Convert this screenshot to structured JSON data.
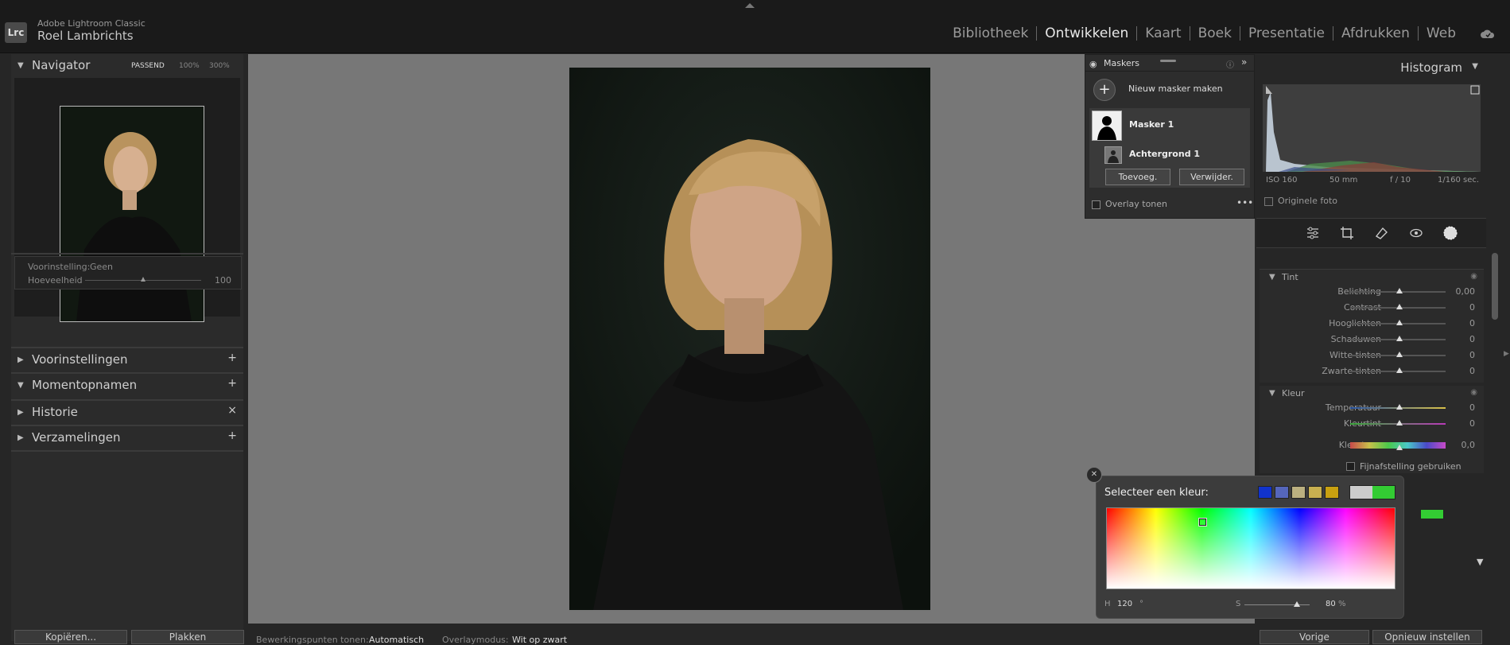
{
  "app": {
    "logo": "Lrc",
    "name": "Adobe Lightroom Classic",
    "user": "Roel Lambrichts"
  },
  "modules": [
    "Bibliotheek",
    "Ontwikkelen",
    "Kaart",
    "Boek",
    "Presentatie",
    "Afdrukken",
    "Web"
  ],
  "active_module": "Ontwikkelen",
  "navigator": {
    "title": "Navigator",
    "zoom": [
      "PASSEND",
      "100%",
      "300%"
    ]
  },
  "preset_box": {
    "label": "Voorinstelling:",
    "value": "Geen",
    "amount_label": "Hoeveelheid",
    "amount": "100"
  },
  "left_panels": [
    {
      "label": "Voorinstellingen",
      "action": "+"
    },
    {
      "label": "Momentopnamen",
      "action": "+"
    },
    {
      "label": "Historie",
      "action": "×"
    },
    {
      "label": "Verzamelingen",
      "action": "+"
    }
  ],
  "left_bottom": {
    "copy": "Kopiëren...",
    "paste": "Plakken"
  },
  "masks": {
    "title": "Maskers",
    "new_mask": "Nieuw masker maken",
    "mask1": "Masker 1",
    "background": "Achtergrond 1",
    "add": "Toevoeg.",
    "remove": "Verwijder.",
    "overlay": "Overlay tonen"
  },
  "histogram": {
    "title": "Histogram",
    "iso": "ISO 160",
    "focal": "50 mm",
    "aperture": "f / 10",
    "shutter": "1/160 sec.",
    "original": "Originele foto"
  },
  "tint": {
    "title": "Tint",
    "sliders": [
      {
        "name": "Belichting",
        "value": "0,00"
      },
      {
        "name": "Contrast",
        "value": "0"
      },
      {
        "name": "Hooglichten",
        "value": "0"
      },
      {
        "name": "Schaduwen",
        "value": "0"
      },
      {
        "name": "Witte tinten",
        "value": "0"
      },
      {
        "name": "Zwarte tinten",
        "value": "0"
      }
    ]
  },
  "color": {
    "title": "Kleur",
    "sliders": [
      {
        "name": "Temperatuur",
        "value": "0"
      },
      {
        "name": "Kleurtint",
        "value": "0"
      }
    ],
    "hue_label": "Kleurtoon",
    "hue_value": "0,0",
    "fine": "Fijnafstelling gebruiken"
  },
  "picker": {
    "title": "Selecteer een kleur:",
    "h_label": "H",
    "h_value": "120",
    "h_unit": "°",
    "s_label": "S",
    "s_value": "80",
    "s_unit": "%",
    "s_level": 0.8,
    "swatches": [
      "#1133cc",
      "#5566bb",
      "#bbb080",
      "#c8b050",
      "#c8a010"
    ],
    "selected_color": "#33cc33"
  },
  "bottom_toolbar": {
    "edit_points_label": "Bewerkingspunten tonen:",
    "edit_points_value": "Automatisch",
    "overlay_mode_label": "Overlaymodus:",
    "overlay_mode_value": "Wit op zwart"
  },
  "right_bottom": {
    "previous": "Vorige",
    "reset": "Opnieuw instellen"
  }
}
